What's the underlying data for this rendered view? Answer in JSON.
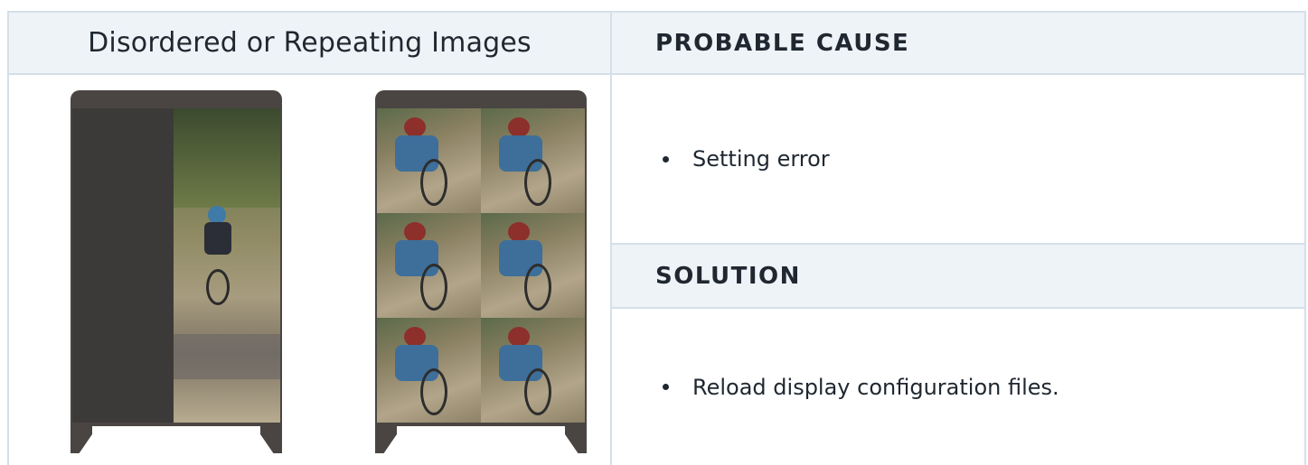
{
  "table": {
    "left_header": "Disordered or Repeating Images",
    "cause_label": "PROBABLE CAUSE",
    "cause_items": [
      "Setting error"
    ],
    "solution_label": "SOLUTION",
    "solution_items": [
      "Reload display configuration files."
    ]
  },
  "colors": {
    "header_bg": "#eef3f7",
    "border": "#d5dfe8",
    "cabinet": "#4a4543"
  },
  "illustrations": [
    {
      "name": "disordered-image-cabinet"
    },
    {
      "name": "repeating-image-cabinet"
    }
  ]
}
